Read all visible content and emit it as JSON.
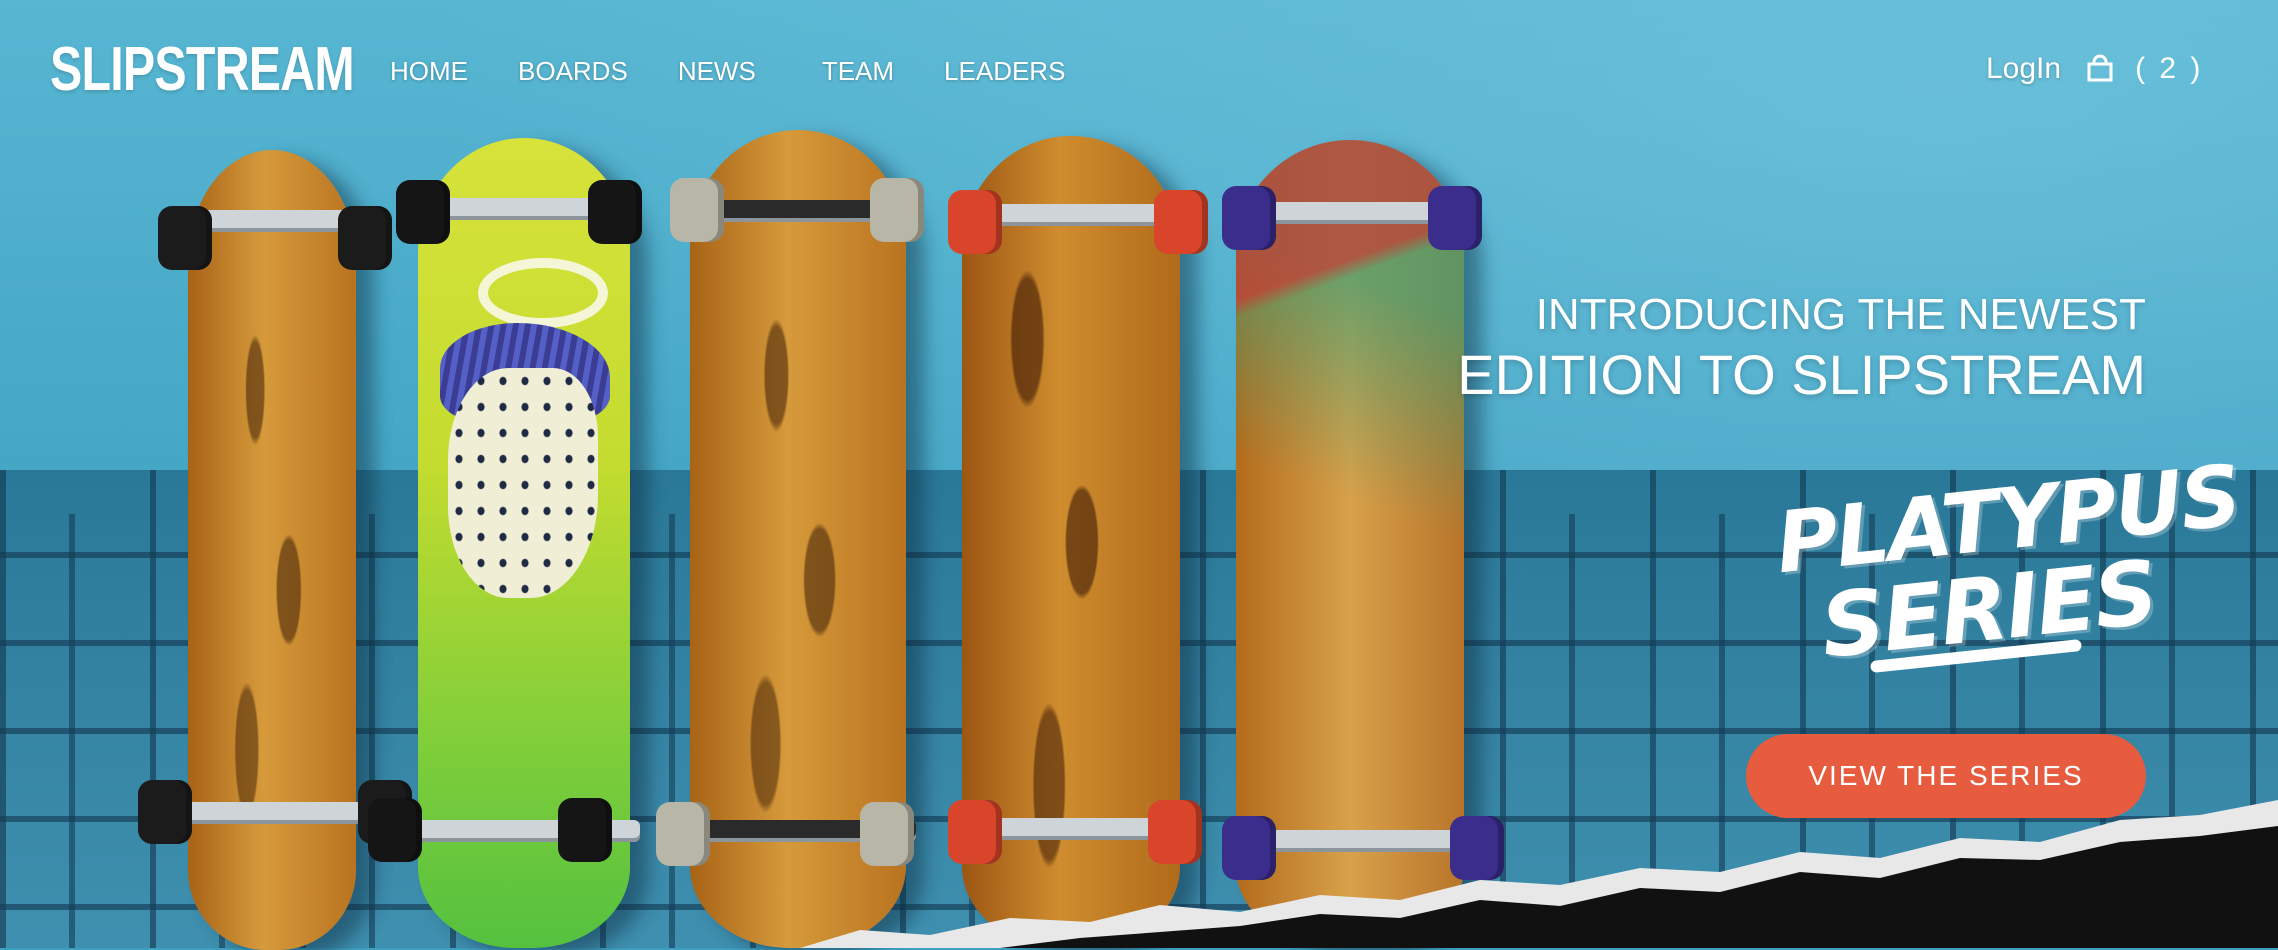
{
  "brand": {
    "logo_text": "SLIPSTREAM"
  },
  "nav": {
    "items": [
      {
        "label": "HOME"
      },
      {
        "label": "BOARDS"
      },
      {
        "label": "NEWS"
      },
      {
        "label": "TEAM"
      },
      {
        "label": "LEADERS"
      }
    ],
    "login_label": "LogIn",
    "cart_icon": "shopping-bag-icon",
    "cart_count": "( 2 )"
  },
  "hero": {
    "headline_line1": "INTRODUCING THE NEWEST",
    "headline_line2": "EDITION TO SLIPSTREAM",
    "series_line1": "PLATYPUS",
    "series_line2": "SERIES",
    "cta_label": "VIEW THE SERIES"
  },
  "colors": {
    "wall": "#48a9c8",
    "cta": "#e75b3e",
    "text": "#ffffff"
  }
}
